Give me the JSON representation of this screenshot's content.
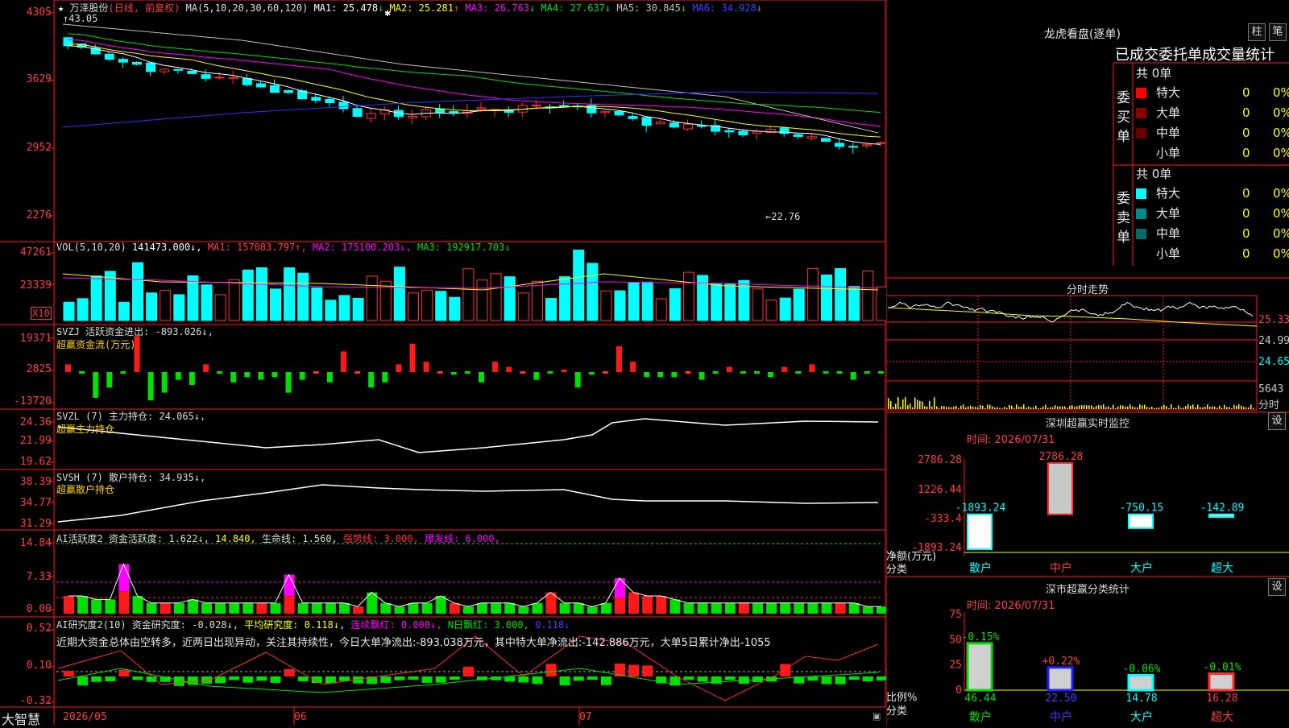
{
  "stock": {
    "name": "万泽股份",
    "period_text": "(日线, 前复权)",
    "ma_label": "MA(5,10,20,30,60,120)",
    "ma": [
      {
        "label": "MA1:",
        "value": "25.478",
        "arrow": "↓",
        "color": "#ffffff"
      },
      {
        "label": "MA2:",
        "value": "25.281",
        "arrow": "↑",
        "color": "#ffff00"
      },
      {
        "label": "MA3:",
        "value": "26.763",
        "arrow": "↓",
        "color": "#ff00ff"
      },
      {
        "label": "MA4:",
        "value": "27.637",
        "arrow": "↓",
        "color": "#00e000"
      },
      {
        "label": "MA5:",
        "value": "30.845",
        "arrow": "↓",
        "color": "#c0c0c0"
      },
      {
        "label": "MA6:",
        "value": "34.928",
        "arrow": "↓",
        "color": "#4040ff"
      }
    ],
    "high_mark": "43.05",
    "low_mark": "←22.76",
    "price_axis": [
      "4305",
      "3629",
      "2952",
      "2276"
    ],
    "date_start": "2026/05",
    "date_labels": [
      "06",
      "07"
    ]
  },
  "volume": {
    "header_prefix": "VOL(5,10,20)",
    "value": "141473.000↓,",
    "ma1": "MA1: 157083.797↑,",
    "ma2": "MA2: 175100.203↓,",
    "ma3": "MA3: 192917.703↓",
    "axis": [
      "47261",
      "23339"
    ],
    "unit": "X10"
  },
  "svzj": {
    "header": "SVZJ  活跃资金进出: -893.026↓,",
    "subtitle": "超赢资金流(万元)",
    "axis": [
      "19371",
      "2825",
      "-13720"
    ],
    "values": [
      3,
      0,
      -10,
      -6,
      0,
      14,
      -11,
      -8,
      -3,
      -5,
      3,
      0,
      -4,
      -2,
      -3,
      -2,
      -8,
      -3,
      0,
      -4,
      8,
      0,
      -6,
      -4,
      3,
      11,
      4,
      0,
      -1,
      0,
      -4,
      4,
      2,
      0,
      -3,
      0,
      1,
      -6,
      -1,
      0,
      10,
      4,
      -2,
      -2,
      -2,
      0,
      -3,
      0,
      2,
      0,
      0,
      -2,
      2,
      0,
      3,
      0,
      0,
      -3,
      0,
      0,
      0,
      0,
      0,
      0,
      0,
      0,
      0,
      0,
      0,
      0,
      0,
      0,
      0,
      0,
      0,
      0,
      0,
      0
    ]
  },
  "svzl": {
    "header": "SVZL (7) 主力持仓: 24.065↓,",
    "subtitle": "超赢主力持仓",
    "axis": [
      "24.36",
      "21.99",
      "19.62"
    ]
  },
  "svsh": {
    "header": "SVSH (7) 散户持仓: 34.935↓,",
    "subtitle": "超赢散户持仓",
    "axis": [
      "38.39",
      "34.77",
      "31.29"
    ]
  },
  "ai_active": {
    "header_prefix": "AI活跃度2 资金活跃度: 1.622↓,",
    "v2": "14.840,",
    "v3": "生命线: 1.560,",
    "v4": "强势线: 3.000,",
    "v5": "爆发线: 6.000,",
    "axis": [
      "14.84",
      "7.33",
      "0.00"
    ]
  },
  "ai_research": {
    "header_prefix": "AI研究度2(10) 资金研究度: -0.028↓,",
    "avg": "平均研究度: 0.118↓,",
    "cont": "连续飘红: 0.000↓,",
    "n": "N日飘红: 3.000,",
    "last": "0.118↓",
    "commentary": "近期大资金总体由空转多，近两日出现异动，关注其持续性，今日大单净流出:-893.038万元，其中特大单净流出:-142.886万元，大单5日累计净出-1055",
    "axis": [
      "0.52",
      "0.10",
      "-0.32"
    ]
  },
  "footer": {
    "brand": "大智慧"
  },
  "right": {
    "dragon_title": "龙虎看盘(逐单)",
    "btn1": "柱",
    "btn2": "笔",
    "tab_title": "已成交委托单成交量统计",
    "buy_label": "委买单",
    "sell_label": "委卖单",
    "buy_total": "共 0单",
    "sell_total": "共 0单",
    "buy_rows": [
      {
        "name": "特大",
        "count": "0",
        "pct": "0%",
        "color": "#ff0000"
      },
      {
        "name": "大单",
        "count": "0",
        "pct": "0%",
        "color": "#8b0000"
      },
      {
        "name": "中单",
        "count": "0",
        "pct": "0%",
        "color": "#6b0000"
      },
      {
        "name": "小单",
        "count": "0",
        "pct": "0%",
        "color": ""
      }
    ],
    "sell_rows": [
      {
        "name": "特大",
        "count": "0",
        "pct": "0%",
        "color": "#00ffff"
      },
      {
        "name": "大单",
        "count": "0",
        "pct": "0%",
        "color": "#008b8b"
      },
      {
        "name": "中单",
        "count": "0",
        "pct": "0%",
        "color": "#006b6b"
      },
      {
        "name": "小单",
        "count": "0",
        "pct": "0%",
        "color": ""
      }
    ],
    "intraday_title": "分时走势",
    "intraday_axis": [
      "25.33",
      "24.99",
      "24.65"
    ],
    "intraday_vol": "5643",
    "intraday_label": "分时",
    "monitor_title": "深圳超赢实时监控",
    "monitor_time": "时间: 2026/07/31",
    "monitor_axis": [
      "2786.28",
      "1226.44",
      "-333.4",
      "-1893.24"
    ],
    "monitor_ylabel": "净额(万元)",
    "monitor_xlabel": "分类",
    "monitor_bars": [
      {
        "cat": "散户",
        "value": -1893.24,
        "label": "-1893.24",
        "cat_color": "#00ffff"
      },
      {
        "cat": "中户",
        "value": 2786.28,
        "label": "2786.28",
        "cat_color": "#ff3c3c"
      },
      {
        "cat": "大户",
        "value": -750.15,
        "label": "-750.15",
        "cat_color": "#00ffff"
      },
      {
        "cat": "超大",
        "value": -142.89,
        "label": "-142.89",
        "cat_color": "#00ffff"
      }
    ],
    "stats_title": "深市超赢分类统计",
    "stats_time": "时间: 2026/07/31",
    "stats_axis": [
      "75",
      "50",
      "25",
      "0"
    ],
    "stats_ylabel": "比例%",
    "stats_xlabel": "分类",
    "stats_bars": [
      {
        "cat": "散户",
        "value": 46.44,
        "label": "46.44",
        "delta": "-0.15%",
        "color": "#00e000"
      },
      {
        "cat": "中户",
        "value": 22.5,
        "label": "22.50",
        "delta": "+0.22%",
        "color": "#2020ff"
      },
      {
        "cat": "大户",
        "value": 14.78,
        "label": "14.78",
        "delta": "-0.06%",
        "color": "#00ffff"
      },
      {
        "cat": "超大",
        "value": 16.28,
        "label": "16.28",
        "delta": "-0.01%",
        "color": "#ff3030"
      }
    ],
    "settings_label": "设"
  }
}
